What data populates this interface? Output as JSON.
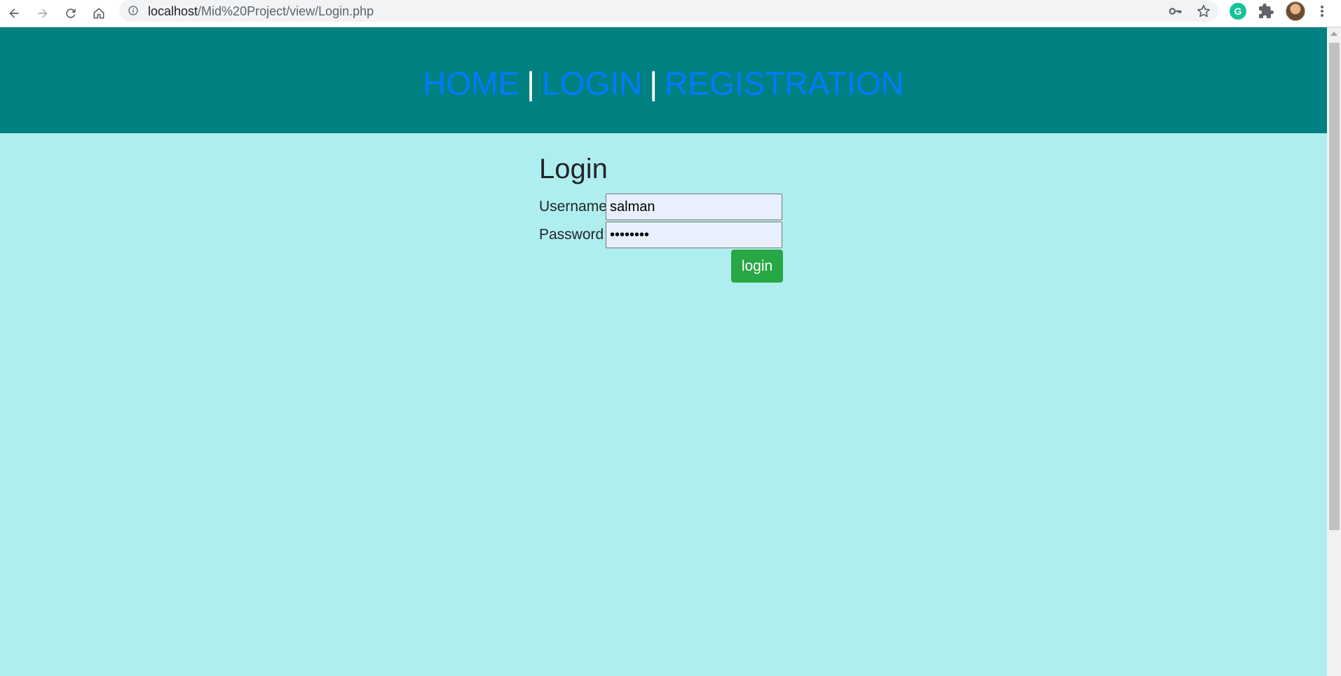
{
  "browser": {
    "url_host": "localhost",
    "url_path": "/Mid%20Project/view/Login.php",
    "icons": {
      "back": "arrow-left-icon",
      "forward": "arrow-right-icon",
      "reload": "reload-icon",
      "home": "home-icon",
      "site_info": "info-icon",
      "password": "key-icon",
      "bookmark": "star-icon",
      "grammarly": "grammarly-icon",
      "extensions": "puzzle-icon",
      "profile": "avatar",
      "menu": "kebab-menu-icon"
    },
    "grammarly_letter": "G"
  },
  "header": {
    "bg_color": "#008080",
    "link_color": "#007bff",
    "links": [
      "HOME",
      "LOGIN",
      "REGISTRATION"
    ],
    "separator": "|"
  },
  "login": {
    "title": "Login",
    "username_label": "Username",
    "username_value": "salman",
    "password_label": "Password",
    "password_value": "••••••••",
    "submit_label": "login",
    "button_color": "#28a745"
  },
  "page": {
    "bg_color": "#afeeee"
  }
}
